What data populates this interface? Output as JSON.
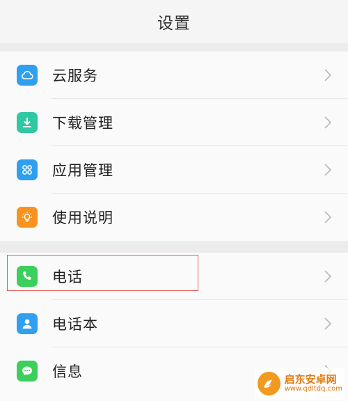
{
  "header": {
    "title": "设置"
  },
  "groups": [
    {
      "items": [
        {
          "label": "云服务",
          "icon": "cloud-icon",
          "color": "#2f9ff0"
        },
        {
          "label": "下载管理",
          "icon": "download-icon",
          "color": "#2ec8a2"
        },
        {
          "label": "应用管理",
          "icon": "apps-icon",
          "color": "#2f9ff0"
        },
        {
          "label": "使用说明",
          "icon": "lightbulb-icon",
          "color": "#f7931e"
        }
      ]
    },
    {
      "items": [
        {
          "label": "电话",
          "icon": "phone-icon",
          "color": "#3ccf5b"
        },
        {
          "label": "电话本",
          "icon": "contacts-icon",
          "color": "#2f9ff0"
        },
        {
          "label": "信息",
          "icon": "message-icon",
          "color": "#3ccf5b"
        }
      ]
    }
  ],
  "highlight_color": "#e15a55",
  "watermark": {
    "name": "启东安卓网",
    "url": "www.qdltdq.com"
  }
}
